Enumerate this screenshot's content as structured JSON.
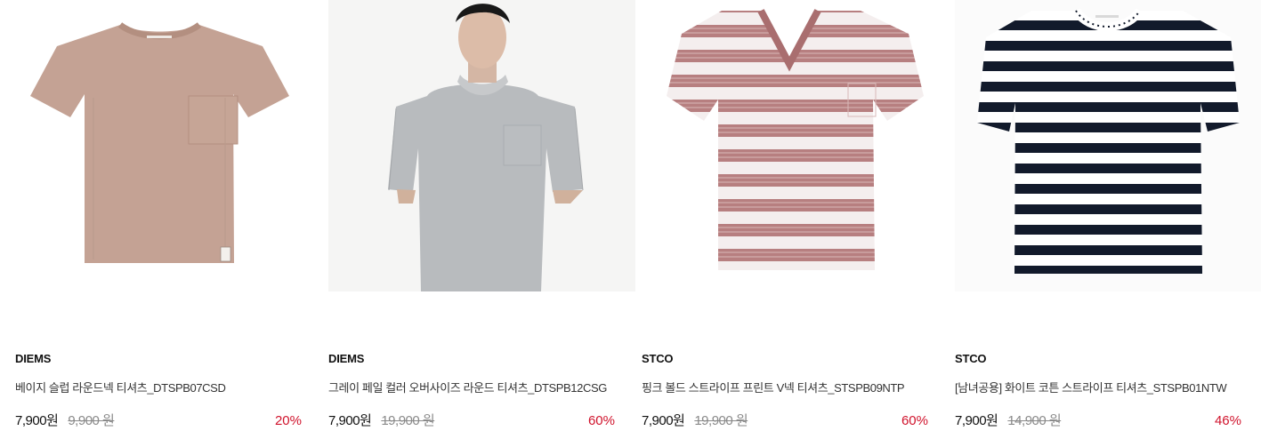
{
  "products": [
    {
      "brand": "DIEMS",
      "name": "베이지 슬럽 라운드넥 티셔츠_DTSPB07CSD",
      "sale_price": "7,900원",
      "original_price": "9,900 원",
      "discount": "20%",
      "image_icon": "beige-pocket-tshirt-image",
      "colors": {
        "shirt": "#c4a294",
        "shadow": "#b38f80"
      }
    },
    {
      "brand": "DIEMS",
      "name": "그레이 페일 컬러 오버사이즈 라운드 티셔츠_DTSPB12CSG",
      "sale_price": "7,900원",
      "original_price": "19,900 원",
      "discount": "60%",
      "image_icon": "gray-oversized-tshirt-model-image",
      "colors": {
        "shirt": "#b8bbbe",
        "background": "#f5f5f4"
      }
    },
    {
      "brand": "STCO",
      "name": "핑크 볼드 스트라이프 프린트 V넥 티셔츠_STSPB09NTP",
      "sale_price": "7,900원",
      "original_price": "19,900 원",
      "discount": "60%",
      "image_icon": "pink-striped-vneck-tshirt-image",
      "colors": {
        "stripe": "#b77f80",
        "base": "#f4eeee"
      }
    },
    {
      "brand": "STCO",
      "name": "[남녀공용] 화이트 코튼 스트라이프 티셔츠_STSPB01NTW",
      "sale_price": "7,900원",
      "original_price": "14,900 원",
      "discount": "46%",
      "image_icon": "navy-white-striped-tshirt-image",
      "colors": {
        "stripe": "#121a2b",
        "base": "#ffffff"
      }
    }
  ],
  "theme": {
    "discount_color": "#d0132c",
    "text_color": "#222222"
  }
}
